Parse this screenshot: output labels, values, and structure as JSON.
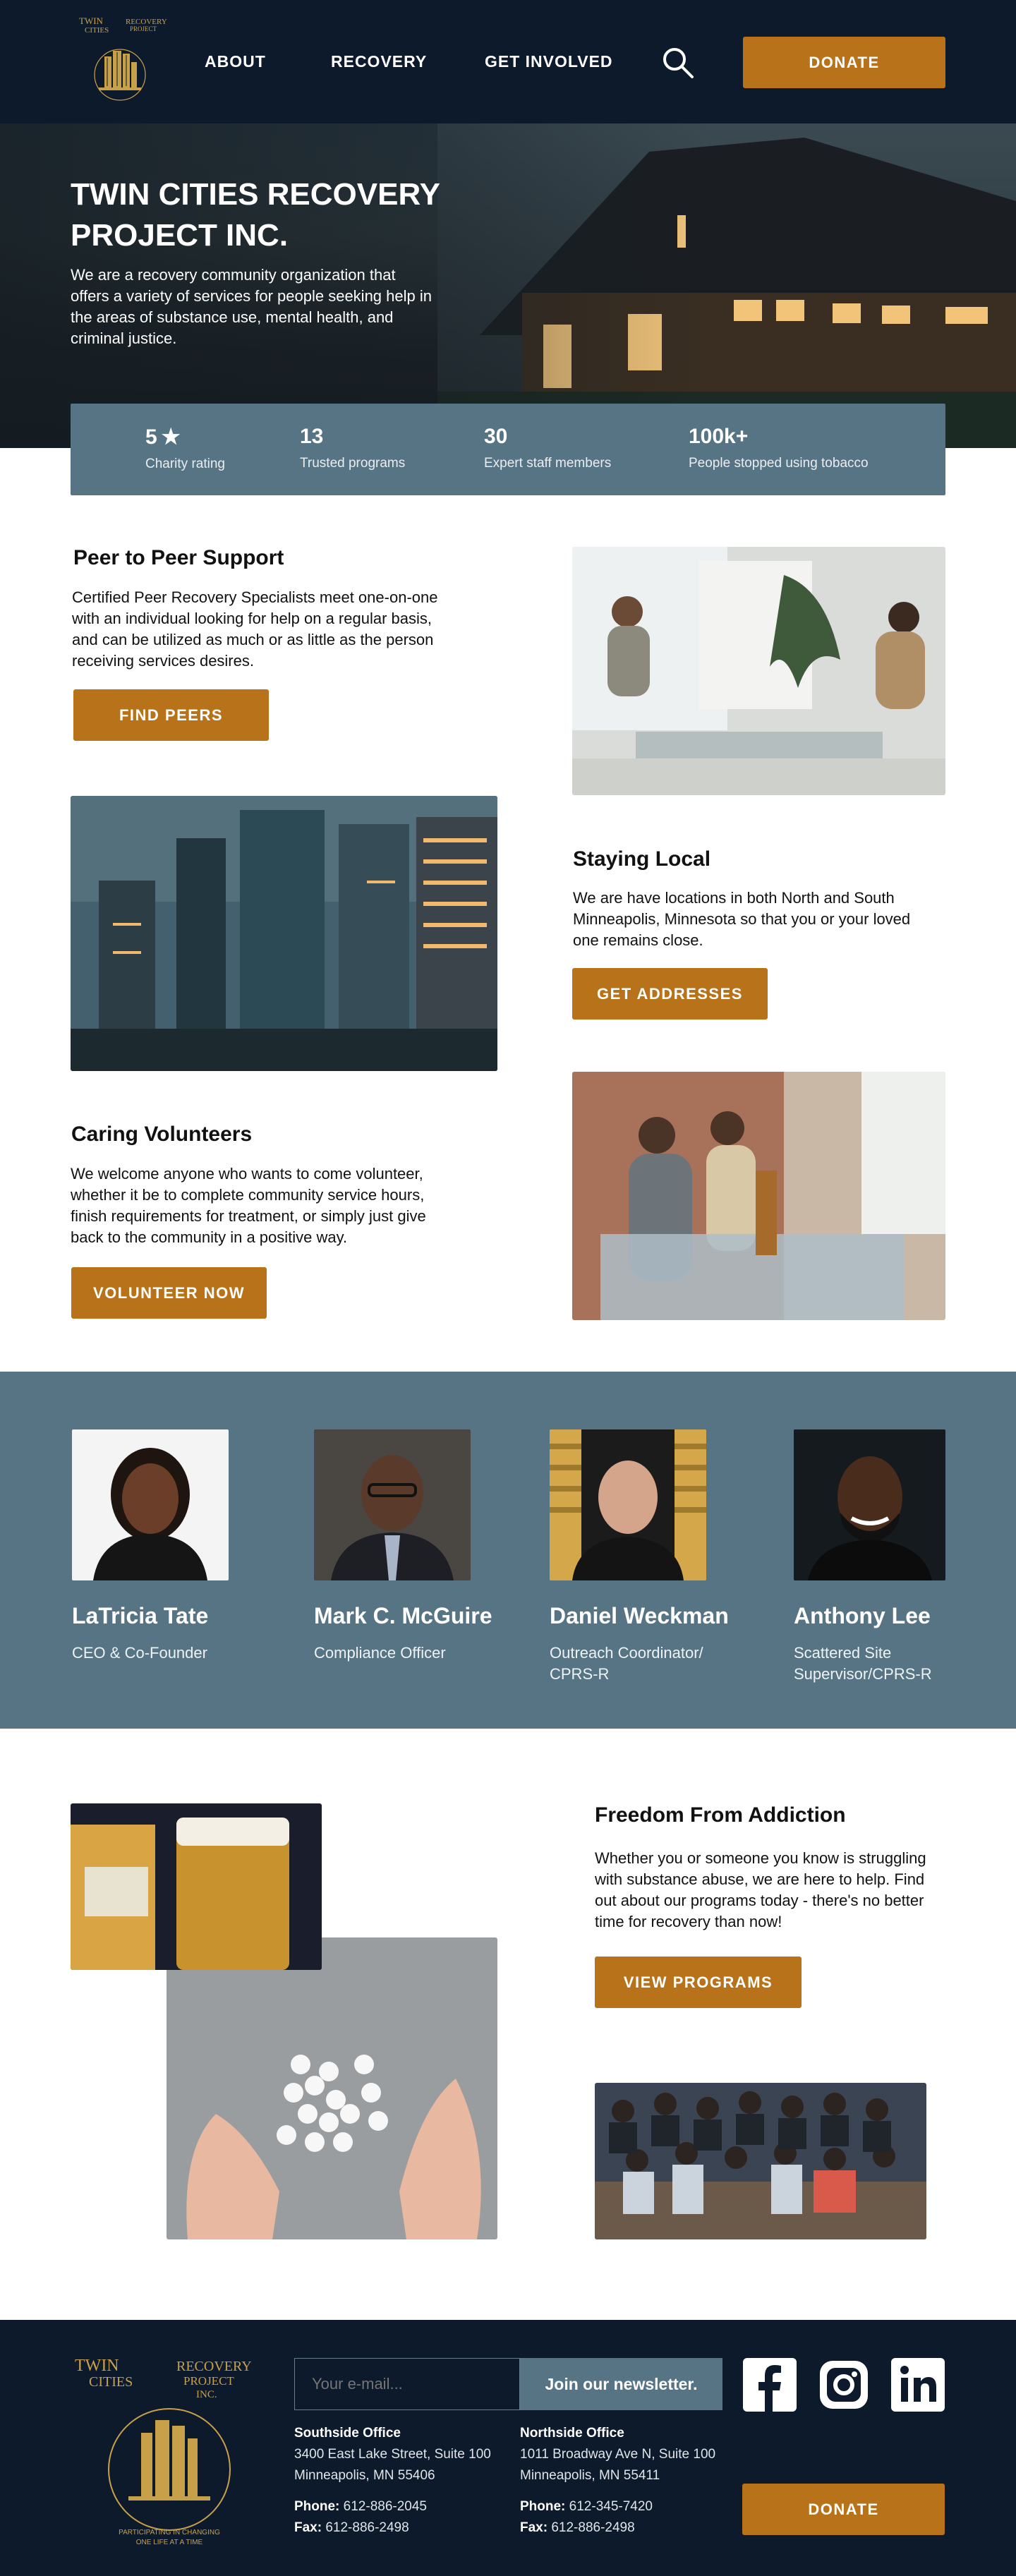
{
  "brand": {
    "logo_name": "Twin Cities Recovery Project logo",
    "accent": "#b8731a",
    "navy": "#0c1a2b",
    "slate": "#577484"
  },
  "nav": {
    "items": [
      {
        "label": "ABOUT"
      },
      {
        "label": "RECOVERY"
      },
      {
        "label": "GET INVOLVED"
      }
    ],
    "search_icon": "search-icon",
    "donate_label": "DONATE"
  },
  "hero": {
    "title": "TWIN CITIES RECOVERY PROJECT INC.",
    "text": "We are a recovery community organization that offers a variety of services for people seeking help in the areas of substance use, mental health, and criminal justice."
  },
  "stats": [
    {
      "value": "5",
      "label": "Charity rating",
      "icon": "star-icon"
    },
    {
      "value": "13",
      "label": "Trusted programs"
    },
    {
      "value": "30",
      "label": "Expert staff members"
    },
    {
      "value": "100k+",
      "label": "People stopped using tobacco"
    }
  ],
  "features": {
    "peer": {
      "title": "Peer to Peer Support",
      "text": "Certified Peer Recovery Specialists meet one-on-one with an individual looking for help on a regular basis, and can be utilized as much or as little as the person receiving services desires.",
      "button": "FIND PEERS"
    },
    "local": {
      "title": "Staying Local",
      "text": "We are have locations in both North and South Minneapolis, Minnesota so that you or your loved one remains close.",
      "button": "GET ADDRESSES"
    },
    "volunteers": {
      "title": "Caring Volunteers",
      "text": "We welcome anyone who wants to come volunteer, whether it be to complete community service hours, finish requirements for treatment, or simply just give back to the community in a positive way.",
      "button": "VOLUNTEER NOW"
    },
    "freedom": {
      "title": "Freedom From Addiction",
      "text": "Whether you or someone you know is struggling with substance abuse, we are here to help. Find out about our programs today - there's no better time for recovery than now!",
      "button": "VIEW PROGRAMS"
    }
  },
  "team": [
    {
      "name": "LaTricia Tate",
      "role": "CEO & Co-Founder"
    },
    {
      "name": "Mark C. McGuire",
      "role": "Compliance Officer"
    },
    {
      "name": "Daniel Weckman",
      "role": "Outreach Coordinator/ CPRS-R"
    },
    {
      "name": "Anthony Lee",
      "role": "Scattered Site Supervisor/CPRS-R"
    }
  ],
  "footer": {
    "newsletter_placeholder": "Your e-mail...",
    "newsletter_button": "Join our newsletter.",
    "offices": [
      {
        "title": "Southside Office",
        "address1": "3400 East Lake Street, Suite 100",
        "address2": "Minneapolis, MN 55406",
        "phone_label": "Phone:",
        "phone": "612-886-2045",
        "fax_label": "Fax:",
        "fax": "612-886-2498"
      },
      {
        "title": "Northside Office",
        "address1": "1011 Broadway Ave N, Suite 100",
        "address2": "Minneapolis, MN 55411",
        "phone_label": "Phone:",
        "phone": "612-345-7420",
        "fax_label": "Fax:",
        "fax": "612-886-2498"
      }
    ],
    "social": [
      "facebook-icon",
      "instagram-icon",
      "linkedin-icon"
    ],
    "donate_label": "DONATE"
  }
}
